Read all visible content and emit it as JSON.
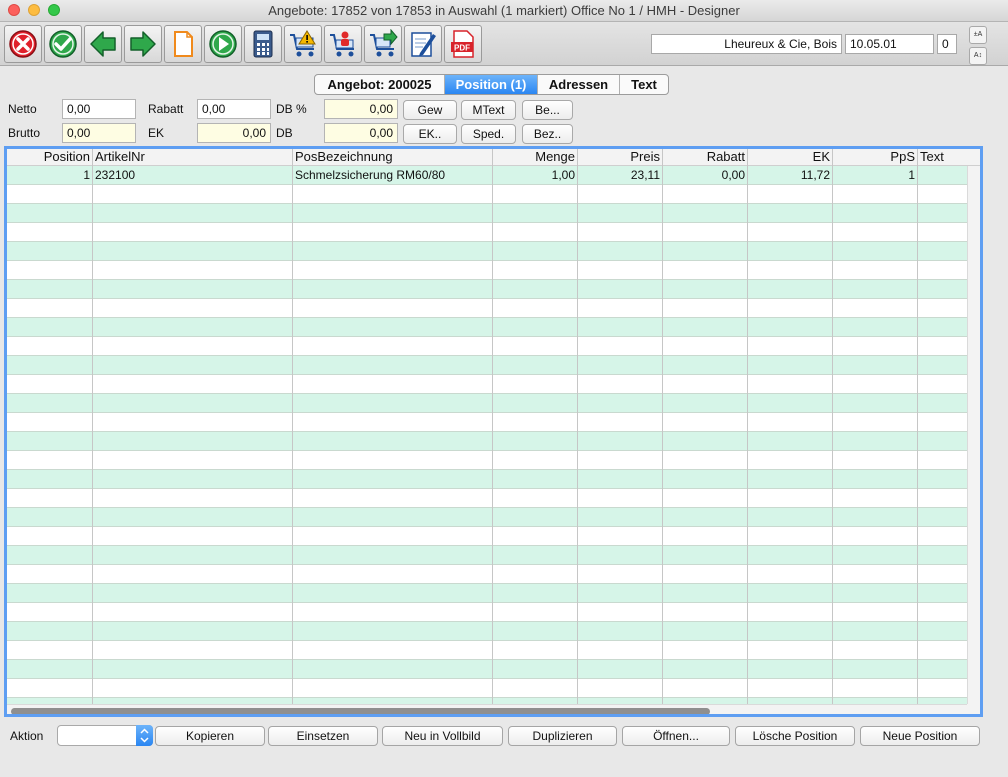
{
  "window": {
    "title": "Angebote: 17852 von 17853 in Auswahl  (1 markiert) Office No 1 /  HMH - Designer"
  },
  "toolbar": {
    "buttons": [
      {
        "icon": "cancel-icon"
      },
      {
        "icon": "checkmark-icon"
      },
      {
        "icon": "back-arrow-icon"
      },
      {
        "icon": "forward-arrow-icon"
      },
      {
        "icon": "new-document-icon"
      },
      {
        "icon": "play-next-icon"
      },
      {
        "icon": "calculator-icon"
      },
      {
        "icon": "cart-warning-icon"
      },
      {
        "icon": "cart-person-icon"
      },
      {
        "icon": "cart-export-icon"
      },
      {
        "icon": "edit-document-icon"
      },
      {
        "icon": "pdf-icon"
      }
    ],
    "customer": "Lheureux & Cie, Bois",
    "date": "10.05.01",
    "counter": "0",
    "font_increase_label": "±A",
    "font_decrease_label": "A↕"
  },
  "tabs": [
    {
      "label": "Angebot: 200025",
      "selected": false
    },
    {
      "label": "Position (1)",
      "selected": true
    },
    {
      "label": "Adressen",
      "selected": false
    },
    {
      "label": "Text",
      "selected": false
    }
  ],
  "totals": {
    "netto_label": "Netto",
    "netto_value": "0,00",
    "rabatt_label": "Rabatt",
    "rabatt_value": "0,00",
    "dbpct_label": "DB %",
    "dbpct_value": "0,00",
    "brutto_label": "Brutto",
    "brutto_value": "0,00",
    "ek_label": "EK",
    "ek_value": "0,00",
    "db_label": "DB",
    "db_value": "0,00"
  },
  "panel_buttons": {
    "gew": "Gew",
    "mtext": "MText",
    "be": "Be...",
    "ek": "EK..",
    "sped": "Sped.",
    "bez": "Bez.."
  },
  "grid": {
    "columns": [
      "Position",
      "ArtikelNr",
      "PosBezeichnung",
      "Menge",
      "Preis",
      "Rabatt",
      "EK",
      "PpS",
      "Text"
    ],
    "rows": [
      {
        "position": "1",
        "artikelnr": "232100",
        "bezeichnung": "Schmelzsicherung RM60/80",
        "menge": "1,00",
        "preis": "23,11",
        "rabatt": "0,00",
        "ek": "11,72",
        "pps": "1",
        "text": ""
      }
    ],
    "colors": {
      "row_alt": "#d6f5e8",
      "selection_border": "#5e9ef2"
    }
  },
  "bottom": {
    "aktion_label": "Aktion",
    "aktion_value": "",
    "buttons": [
      "Kopieren",
      "Einsetzen",
      "Neu in Vollbild",
      "Duplizieren",
      "Öffnen...",
      "Lösche Position",
      "Neue Position"
    ]
  }
}
